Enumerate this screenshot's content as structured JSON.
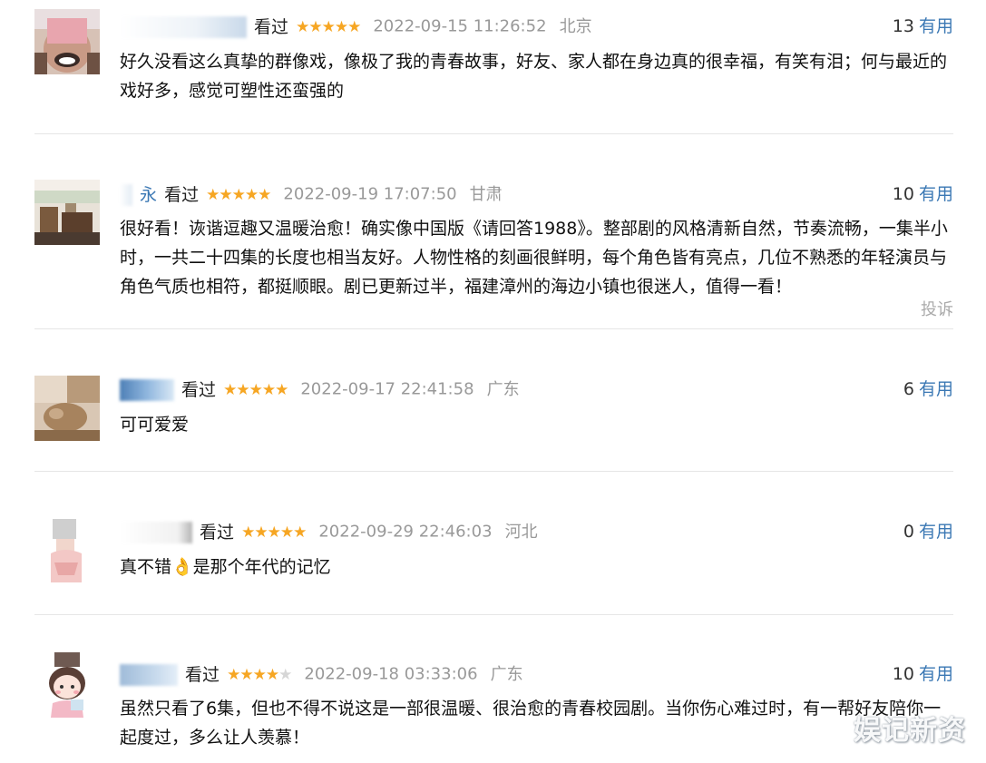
{
  "comments": [
    {
      "username": "",
      "username_visible_tail": "",
      "watched": "看过",
      "stars": "★★★★★",
      "stars_off": "",
      "time": "2022-09-15 11:26:52",
      "location": "北京",
      "votes": "13",
      "useful_label": "有用",
      "content": "好久没看这么真挚的群像戏，像极了我的青春故事，好友、家人都在身边真的很幸福，有笑有泪；何与最近的戏好多，感觉可塑性还蛮强的",
      "avatar": "face-avatar"
    },
    {
      "username": "",
      "username_visible_tail": "永",
      "watched": "看过",
      "stars": "★★★★★",
      "stars_off": "",
      "time": "2022-09-19 17:07:50",
      "location": "甘肃",
      "votes": "10",
      "useful_label": "有用",
      "content": "很好看！诙谐逗趣又温暖治愈！确实像中国版《请回答1988》。整部剧的风格清新自然，节奏流畅，一集半小时，一共二十四集的长度也相当友好。人物性格的刻画很鲜明，每个角色皆有亮点，几位不熟悉的年轻演员与角色气质也相符，都挺顺眼。剧已更新过半，福建漳州的海边小镇也很迷人，值得一看！",
      "report": "投诉",
      "avatar": "room-avatar"
    },
    {
      "username": "",
      "username_visible_tail": "",
      "watched": "看过",
      "stars": "★★★★★",
      "stars_off": "",
      "time": "2022-09-17 22:41:58",
      "location": "广东",
      "votes": "6",
      "useful_label": "有用",
      "content": "可可爱爱",
      "avatar": "pet-avatar"
    },
    {
      "username": "",
      "username_visible_tail": "",
      "watched": "看过",
      "stars": "★★★★★",
      "stars_off": "",
      "time": "2022-09-29 22:46:03",
      "location": "河北",
      "votes": "0",
      "useful_label": "有用",
      "content": "真不错👌是那个年代的记忆",
      "avatar": "girl-avatar"
    },
    {
      "username": "",
      "username_visible_tail": "",
      "watched": "看过",
      "stars": "★★★★",
      "stars_off": "★",
      "time": "2022-09-18 03:33:06",
      "location": "广东",
      "votes": "10",
      "useful_label": "有用",
      "content": "虽然只看了6集，但也不得不说这是一部很温暖、很治愈的青春校园剧。当你伤心难过时，有一帮好友陪你一起度过，多么让人羡慕！",
      "avatar": "cartoon-avatar"
    }
  ],
  "watermark": "娱记新资",
  "colors": {
    "star": "#f6a623",
    "useful_link": "#3b78b4",
    "meta_gray": "#999999",
    "divider": "#e6e6e6"
  }
}
